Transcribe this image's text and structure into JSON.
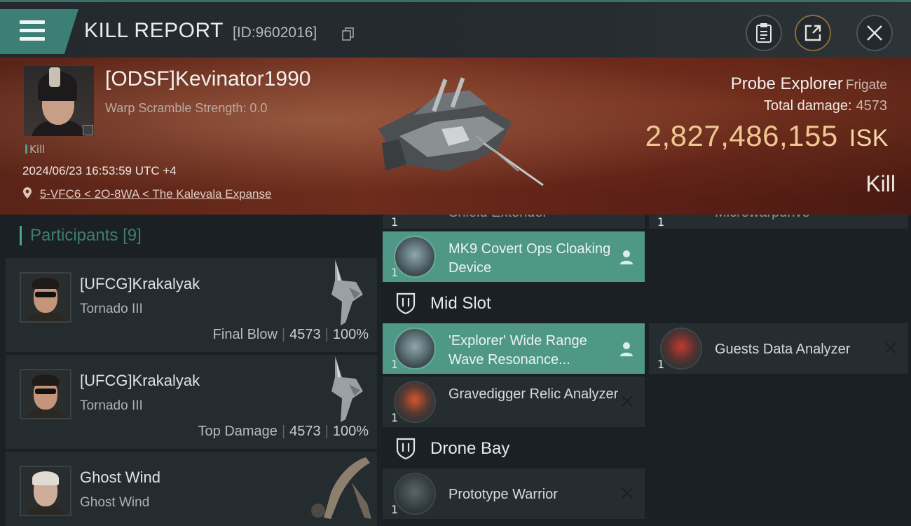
{
  "header": {
    "title": "KILL REPORT",
    "report_id": "[ID:9602016]"
  },
  "victim": {
    "name": "[ODSF]Kevinator1990",
    "warp_scramble": "Warp Scramble Strength: 0.0",
    "tag": "Kill",
    "timestamp": "2024/06/23 16:53:59 UTC +4",
    "location": "5-VFC6 < 2O-8WA < The Kalevala Expanse",
    "ship": "Probe Explorer",
    "ship_class": "Frigate",
    "total_damage_label": "Total damage:",
    "total_damage": "4573",
    "isk_value": "2,827,486,155",
    "isk_unit": "ISK",
    "result": "Kill"
  },
  "participants": {
    "label": "Participants",
    "count": "[9]",
    "items": [
      {
        "name": "[UFCG]Krakalyak",
        "ship": "Tornado III",
        "role": "Final Blow",
        "damage": "4573",
        "percent": "100%"
      },
      {
        "name": "[UFCG]Krakalyak",
        "ship": "Tornado III",
        "role": "Top Damage",
        "damage": "4573",
        "percent": "100%"
      },
      {
        "name": "Ghost Wind",
        "ship": "Ghost Wind",
        "role": "",
        "damage": "",
        "percent": ""
      }
    ]
  },
  "fitting": {
    "partial_top_left": "Shield Extender",
    "partial_top_right": "Microwarpdrive",
    "high_slot": [
      {
        "name": "MK9 Covert Ops Cloaking Device",
        "qty": "1",
        "status": "dropped"
      }
    ],
    "mid_slot_label": "Mid Slot",
    "mid_slot": [
      {
        "name": "'Explorer' Wide Range Wave Resonance...",
        "qty": "1",
        "status": "dropped"
      },
      {
        "name": "Guests Data Analyzer",
        "qty": "1",
        "status": "destroyed"
      },
      {
        "name": "Gravedigger Relic Analyzer",
        "qty": "1",
        "status": "destroyed"
      }
    ],
    "drone_bay_label": "Drone Bay",
    "drone_bay": [
      {
        "name": "Prototype  Warrior",
        "qty": "1",
        "status": "destroyed"
      }
    ]
  },
  "colors": {
    "accent": "#4f9887",
    "isk_gold": "#eec890",
    "banner_red": "#6d2c1c"
  },
  "icons": {
    "menu": "hamburger-icon",
    "copy": "copy-icon",
    "clipboard": "clipboard-icon",
    "share": "share-icon",
    "close": "close-icon",
    "location": "location-pin-icon",
    "dropped": "person-icon",
    "destroyed": "x-icon"
  }
}
